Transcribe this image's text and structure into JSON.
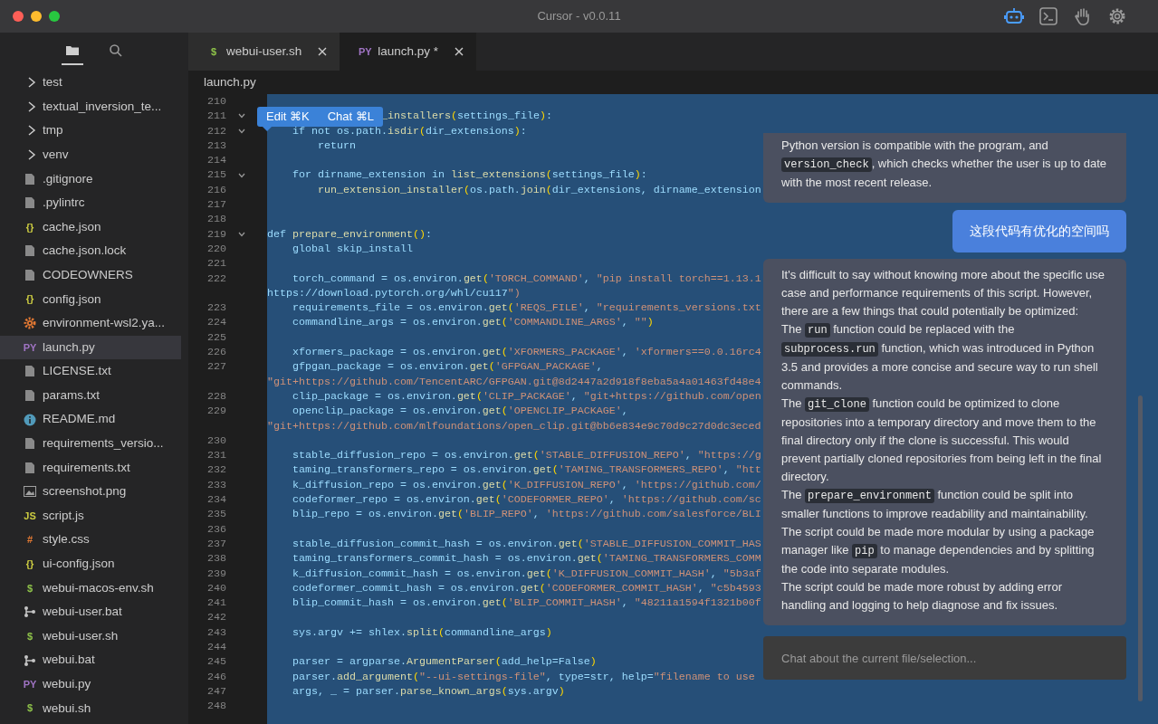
{
  "window": {
    "title": "Cursor - v0.0.11"
  },
  "toolbar": [
    {
      "kind": "robot",
      "active": true
    },
    {
      "kind": "terminal",
      "active": false
    },
    {
      "kind": "hand",
      "active": false
    },
    {
      "kind": "settings",
      "active": false
    }
  ],
  "sidebar": {
    "views": [
      {
        "kind": "files",
        "selected": true
      },
      {
        "kind": "search",
        "selected": false
      }
    ],
    "items": [
      {
        "label": "test",
        "kind": "folder",
        "selected": false
      },
      {
        "label": "textual_inversion_te...",
        "kind": "folder",
        "selected": false
      },
      {
        "label": "tmp",
        "kind": "folder",
        "selected": false
      },
      {
        "label": "venv",
        "kind": "folder",
        "selected": false
      },
      {
        "label": ".gitignore",
        "kind": "file",
        "selected": false
      },
      {
        "label": ".pylintrc",
        "kind": "file",
        "selected": false
      },
      {
        "label": "cache.json",
        "kind": "json",
        "glyph": "{}",
        "selected": false
      },
      {
        "label": "cache.json.lock",
        "kind": "file",
        "selected": false
      },
      {
        "label": "CODEOWNERS",
        "kind": "file",
        "selected": false
      },
      {
        "label": "config.json",
        "kind": "json",
        "glyph": "{}",
        "selected": false
      },
      {
        "label": "environment-wsl2.ya...",
        "kind": "gear",
        "selected": false
      },
      {
        "label": "launch.py",
        "kind": "python",
        "glyph": "PY",
        "selected": true
      },
      {
        "label": "LICENSE.txt",
        "kind": "file",
        "selected": false
      },
      {
        "label": "params.txt",
        "kind": "file",
        "selected": false
      },
      {
        "label": "README.md",
        "kind": "info",
        "selected": false
      },
      {
        "label": "requirements_versio...",
        "kind": "file",
        "selected": false
      },
      {
        "label": "requirements.txt",
        "kind": "file",
        "selected": false
      },
      {
        "label": "screenshot.png",
        "kind": "image",
        "selected": false
      },
      {
        "label": "script.js",
        "kind": "js",
        "glyph": "JS",
        "selected": false
      },
      {
        "label": "style.css",
        "kind": "css",
        "glyph": "#",
        "selected": false
      },
      {
        "label": "ui-config.json",
        "kind": "json",
        "glyph": "{}",
        "selected": false
      },
      {
        "label": "webui-macos-env.sh",
        "kind": "shell",
        "glyph": "$",
        "selected": false
      },
      {
        "label": "webui-user.bat",
        "kind": "bat",
        "selected": false
      },
      {
        "label": "webui-user.sh",
        "kind": "shell",
        "glyph": "$",
        "selected": false
      },
      {
        "label": "webui.bat",
        "kind": "bat",
        "selected": false
      },
      {
        "label": "webui.py",
        "kind": "python",
        "glyph": "PY",
        "selected": false
      },
      {
        "label": "webui.sh",
        "kind": "shell",
        "glyph": "$",
        "selected": false
      }
    ]
  },
  "tabs": [
    {
      "label": "webui-user.sh",
      "kind": "shell",
      "glyph": "$",
      "selected": false
    },
    {
      "label": "launch.py *",
      "kind": "python",
      "glyph": "PY",
      "selected": true
    }
  ],
  "breadcrumb": "launch.py",
  "selection_popup": {
    "buttons": [
      "Edit ⌘K",
      "Chat ⌘L"
    ]
  },
  "editor": {
    "lines": [
      {
        "n": "210",
        "fold": false
      },
      {
        "n": "211",
        "text": "                  _installers(settings_file):",
        "fold": true
      },
      {
        "n": "212",
        "text": "    if not os.path.isdir(dir_extensions):",
        "fold": true
      },
      {
        "n": "213",
        "text": "        return",
        "fold": false
      },
      {
        "n": "214",
        "fold": false
      },
      {
        "n": "215",
        "text": "    for dirname_extension in list_extensions(settings_file):",
        "fold": true
      },
      {
        "n": "216",
        "text": "        run_extension_installer(os.path.join(dir_extensions, dirname_extension",
        "fold": false
      },
      {
        "n": "217",
        "fold": false
      },
      {
        "n": "218",
        "fold": false
      },
      {
        "n": "219",
        "text": "def prepare_environment():",
        "fold": true
      },
      {
        "n": "220",
        "text": "    global skip_install",
        "fold": false
      },
      {
        "n": "221",
        "fold": false
      },
      {
        "n": "222",
        "text": "    torch_command = os.environ.get('TORCH_COMMAND', \"pip install torch==1.13.1",
        "wrap": "https://download.pytorch.org/whl/cu117\")",
        "fold": false
      },
      {
        "n": "223",
        "text": "    requirements_file = os.environ.get('REQS_FILE', \"requirements_versions.txt",
        "fold": false
      },
      {
        "n": "224",
        "text": "    commandline_args = os.environ.get('COMMANDLINE_ARGS', \"\")",
        "fold": false
      },
      {
        "n": "225",
        "fold": false
      },
      {
        "n": "226",
        "text": "    xformers_package = os.environ.get('XFORMERS_PACKAGE', 'xformers==0.0.16rc4",
        "fold": false
      },
      {
        "n": "227",
        "text": "    gfpgan_package = os.environ.get('GFPGAN_PACKAGE',",
        "wrap": "\"git+https://github.com/TencentARC/GFPGAN.git@8d2447a2d918f8eba5a4a01463fd48e4",
        "fold": false
      },
      {
        "n": "228",
        "text": "    clip_package = os.environ.get('CLIP_PACKAGE', \"git+https://github.com/open",
        "fold": false
      },
      {
        "n": "229",
        "text": "    openclip_package = os.environ.get('OPENCLIP_PACKAGE',",
        "wrap": "\"git+https://github.com/mlfoundations/open_clip.git@bb6e834e9c70d9c27d0dc3eced",
        "fold": false
      },
      {
        "n": "230",
        "fold": false
      },
      {
        "n": "231",
        "text": "    stable_diffusion_repo = os.environ.get('STABLE_DIFFUSION_REPO', \"https://g",
        "fold": false
      },
      {
        "n": "232",
        "text": "    taming_transformers_repo = os.environ.get('TAMING_TRANSFORMERS_REPO', \"htt",
        "fold": false
      },
      {
        "n": "233",
        "text": "    k_diffusion_repo = os.environ.get('K_DIFFUSION_REPO', 'https://github.com/",
        "fold": false
      },
      {
        "n": "234",
        "text": "    codeformer_repo = os.environ.get('CODEFORMER_REPO', 'https://github.com/sc",
        "fold": false
      },
      {
        "n": "235",
        "text": "    blip_repo = os.environ.get('BLIP_REPO', 'https://github.com/salesforce/BLI",
        "fold": false
      },
      {
        "n": "236",
        "fold": false
      },
      {
        "n": "237",
        "text": "    stable_diffusion_commit_hash = os.environ.get('STABLE_DIFFUSION_COMMIT_HAS",
        "fold": false
      },
      {
        "n": "238",
        "text": "    taming_transformers_commit_hash = os.environ.get('TAMING_TRANSFORMERS_COMM",
        "fold": false
      },
      {
        "n": "239",
        "text": "    k_diffusion_commit_hash = os.environ.get('K_DIFFUSION_COMMIT_HASH', \"5b3af",
        "fold": false
      },
      {
        "n": "240",
        "text": "    codeformer_commit_hash = os.environ.get('CODEFORMER_COMMIT_HASH', \"c5b4593",
        "fold": false
      },
      {
        "n": "241",
        "text": "    blip_commit_hash = os.environ.get('BLIP_COMMIT_HASH', \"48211a1594f1321b00f",
        "fold": false
      },
      {
        "n": "242",
        "fold": false
      },
      {
        "n": "243",
        "text": "    sys.argv += shlex.split(commandline_args)",
        "fold": false
      },
      {
        "n": "244",
        "fold": false
      },
      {
        "n": "245",
        "text": "    parser = argparse.ArgumentParser(add_help=False)",
        "fold": false
      },
      {
        "n": "246",
        "text": "    parser.add_argument(\"--ui-settings-file\", type=str, help=\"filename to use",
        "fold": false
      },
      {
        "n": "247",
        "text": "    args, _ = parser.parse_known_args(sys.argv)",
        "fold": false
      },
      {
        "n": "248",
        "fold": false
      }
    ]
  },
  "chat": {
    "messages": [
      {
        "kind": "assistant",
        "paragraphs": [
          [
            {
              "kind": "text",
              "text": "Python version is compatible with the program, and "
            },
            {
              "kind": "code",
              "text": "version_check"
            },
            {
              "kind": "text",
              "text": ", which checks whether the user is up to date with the most recent release."
            }
          ]
        ]
      },
      {
        "kind": "user",
        "paragraphs": [
          [
            {
              "kind": "text",
              "text": "这段代码有优化的空间吗"
            }
          ]
        ]
      },
      {
        "kind": "assistant",
        "paragraphs": [
          [
            {
              "kind": "text",
              "text": "It's difficult to say without knowing more about the specific use case and performance requirements of this script. However, there are a few things that could potentially be optimized:"
            }
          ],
          [
            {
              "kind": "text",
              "text": "The "
            },
            {
              "kind": "code",
              "text": "run"
            },
            {
              "kind": "text",
              "text": " function could be replaced with the "
            },
            {
              "kind": "code",
              "text": "subprocess.run"
            },
            {
              "kind": "text",
              "text": " function, which was introduced in Python 3.5 and provides a more concise and secure way to run shell commands."
            }
          ],
          [
            {
              "kind": "text",
              "text": "The "
            },
            {
              "kind": "code",
              "text": "git_clone"
            },
            {
              "kind": "text",
              "text": " function could be optimized to clone repositories into a temporary directory and move them to the final directory only if the clone is successful. This would prevent partially cloned repositories from being left in the final directory."
            }
          ],
          [
            {
              "kind": "text",
              "text": "The "
            },
            {
              "kind": "code",
              "text": "prepare_environment"
            },
            {
              "kind": "text",
              "text": " function could be split into smaller functions to improve readability and maintainability."
            }
          ],
          [
            {
              "kind": "text",
              "text": "The script could be made more modular by using a package manager like "
            },
            {
              "kind": "code",
              "text": "pip"
            },
            {
              "kind": "text",
              "text": " to manage dependencies and by splitting the code into separate modules."
            }
          ],
          [
            {
              "kind": "text",
              "text": "The script could be made more robust by adding error handling and logging to help diagnose and fix issues."
            }
          ]
        ]
      }
    ],
    "input": {
      "placeholder": "Chat about the current file/selection..."
    }
  }
}
